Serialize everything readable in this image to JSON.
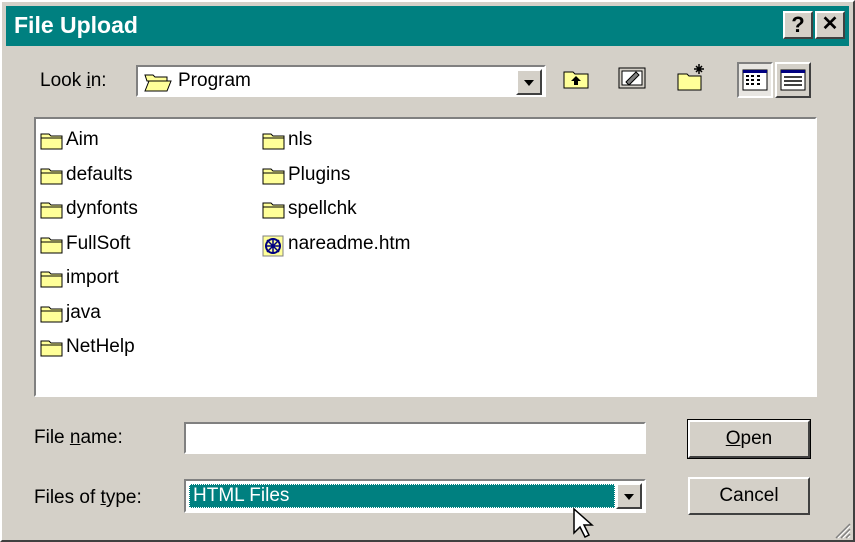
{
  "titlebar": {
    "title": "File Upload",
    "help": "?",
    "close": "✕"
  },
  "lookin": {
    "label_pre": "Look ",
    "label_u": "i",
    "label_post": "n:",
    "value": "Program"
  },
  "files": [
    {
      "name": "Aim",
      "type": "folder"
    },
    {
      "name": "defaults",
      "type": "folder"
    },
    {
      "name": "dynfonts",
      "type": "folder"
    },
    {
      "name": "FullSoft",
      "type": "folder"
    },
    {
      "name": "import",
      "type": "folder"
    },
    {
      "name": "java",
      "type": "folder"
    },
    {
      "name": "NetHelp",
      "type": "folder"
    },
    {
      "name": "nls",
      "type": "folder"
    },
    {
      "name": "Plugins",
      "type": "folder"
    },
    {
      "name": "spellchk",
      "type": "folder"
    },
    {
      "name": "nareadme.htm",
      "type": "html"
    }
  ],
  "filename": {
    "label_pre": "File ",
    "label_u": "n",
    "label_post": "ame:",
    "value": ""
  },
  "filetype": {
    "label_pre": "Files of ",
    "label_u": "t",
    "label_post": "ype:",
    "value": "HTML Files"
  },
  "buttons": {
    "open_u": "O",
    "open_rest": "pen",
    "cancel": "Cancel"
  },
  "colors": {
    "titlebar": "#008080",
    "selection": "#008080",
    "face": "#d4d0c8",
    "folder": "#ffff99"
  }
}
